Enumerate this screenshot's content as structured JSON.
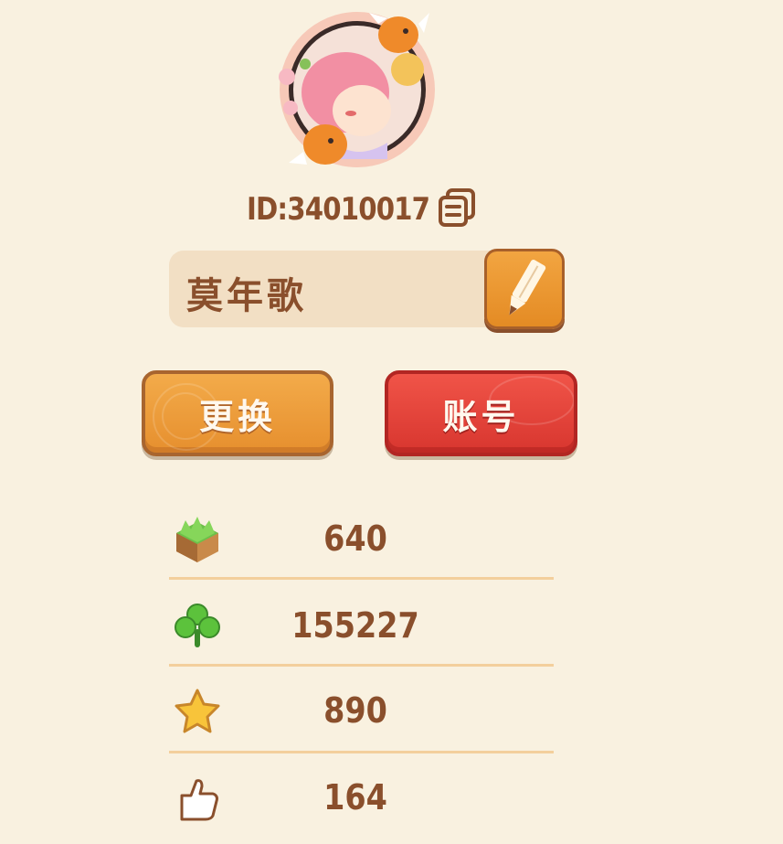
{
  "profile": {
    "id_text": "ID:34010017",
    "nickname": "莫年歌"
  },
  "buttons": {
    "change_label": "更换",
    "account_label": "账号"
  },
  "stats": [
    {
      "icon": "grass-block-icon",
      "value": "640"
    },
    {
      "icon": "clover-icon",
      "value": "155227"
    },
    {
      "icon": "star-icon",
      "value": "890"
    },
    {
      "icon": "thumbs-up-icon",
      "value": "164"
    }
  ],
  "colors": {
    "background": "#f9f1e0",
    "text_brown": "#8a4f2c",
    "orange_button": "#eb9a37",
    "red_button": "#e4443b",
    "separator": "#f3cf9c"
  }
}
